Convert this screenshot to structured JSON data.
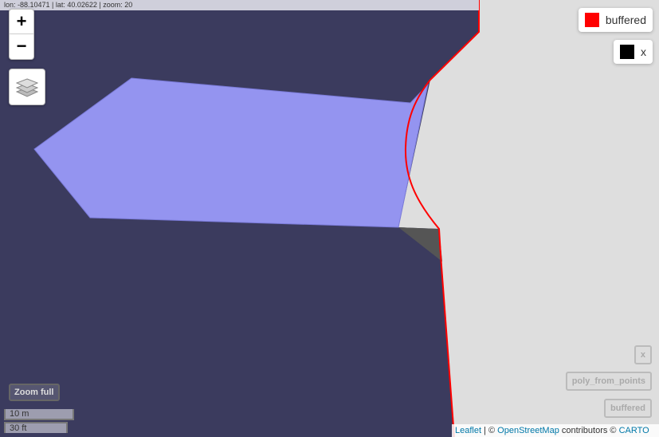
{
  "coords": {
    "text": "lon: -88.10471 | lat: 40.02622 | zoom: 20"
  },
  "zoom": {
    "in_label": "+",
    "out_label": "−"
  },
  "legend": [
    {
      "label": "buffered",
      "color": "#ff0000"
    },
    {
      "label": "x",
      "color": "#000000"
    }
  ],
  "layer_buttons": {
    "x": "x",
    "poly_from_points": "poly_from_points",
    "buffered": "buffered"
  },
  "zoom_full_label": "Zoom full",
  "scale": {
    "metric": "10 m",
    "imperial": "30 ft"
  },
  "attribution": {
    "leaflet": "Leaflet",
    "sep": " | © ",
    "osm": "OpenStreetMap",
    "contrib": " contributors © ",
    "carto": "CARTO"
  },
  "colors": {
    "water": "#3b3b5e",
    "land": "#dedede",
    "polygon_fill": "#9494f0",
    "buffered_stroke": "#ff0000",
    "shadow": "#555555"
  }
}
